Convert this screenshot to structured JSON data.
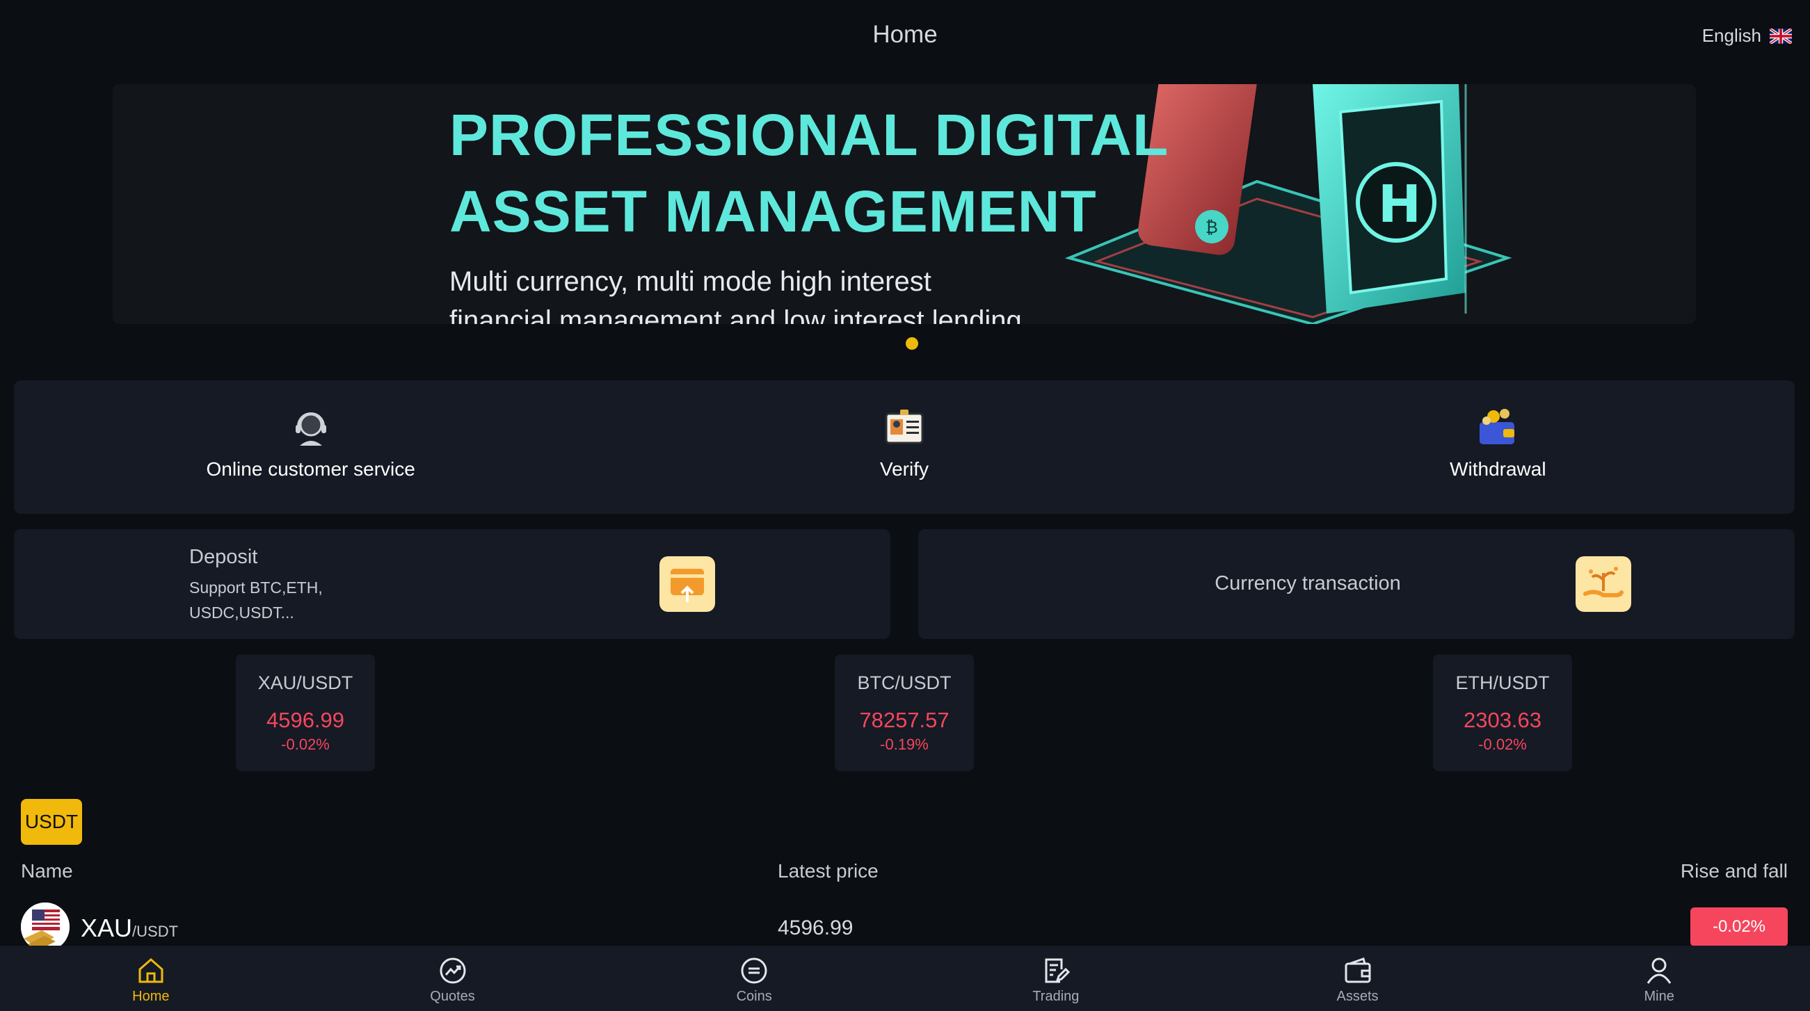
{
  "header": {
    "title": "Home",
    "language": "English"
  },
  "banner": {
    "headline_line1": "PROFESSIONAL DIGITAL",
    "headline_line2": "ASSET MANAGEMENT",
    "sub_line1": "Multi currency, multi mode high interest",
    "sub_line2": "financial management and low interest lending"
  },
  "quick_actions": [
    {
      "label": "Online customer service",
      "icon": "headset-icon"
    },
    {
      "label": "Verify",
      "icon": "id-card-icon"
    },
    {
      "label": "Withdrawal",
      "icon": "wallet-coins-icon"
    }
  ],
  "deposit": {
    "title": "Deposit",
    "subtitle": "Support BTC,ETH, USDC,USDT..."
  },
  "currency_transaction": {
    "title": "Currency transaction"
  },
  "tickers": [
    {
      "pair": "XAU/USDT",
      "price": "4596.99",
      "change": "-0.02%"
    },
    {
      "pair": "BTC/USDT",
      "price": "78257.57",
      "change": "-0.19%"
    },
    {
      "pair": "ETH/USDT",
      "price": "2303.63",
      "change": "-0.02%"
    }
  ],
  "market": {
    "tab": "USDT",
    "columns": {
      "name": "Name",
      "price": "Latest price",
      "change": "Rise and fall"
    },
    "rows": [
      {
        "symbol": "XAU",
        "quote": "/USDT",
        "price": "4596.99",
        "change": "-0.02%"
      }
    ]
  },
  "nav": [
    {
      "label": "Home",
      "icon": "home-icon",
      "active": true
    },
    {
      "label": "Quotes",
      "icon": "chart-circle-icon"
    },
    {
      "label": "Coins",
      "icon": "coin-icon"
    },
    {
      "label": "Trading",
      "icon": "document-edit-icon"
    },
    {
      "label": "Assets",
      "icon": "wallet-icon"
    },
    {
      "label": "Mine",
      "icon": "user-icon"
    }
  ],
  "colors": {
    "accent": "#f0b90b",
    "down": "#f6465d",
    "teal": "#5ee8dc",
    "panel": "#151a24"
  }
}
